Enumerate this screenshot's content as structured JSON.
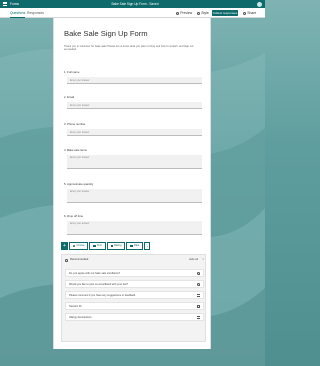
{
  "titlebar": {
    "app_name": "Forms",
    "title": "Bake Sale Sign Up Form - Saved"
  },
  "tabs": {
    "questions": "Questions",
    "responses": "Responses"
  },
  "commands": {
    "preview": "Preview",
    "style": "Style",
    "collect": "Collect responses",
    "share": "Share"
  },
  "form": {
    "title": "Bake Sale Sign Up Form",
    "description": "Thank you to volunteer for bake sale! Please let us know what you plan to bring and how to contact, and help out as needed.",
    "questions": [
      {
        "number": "1.",
        "label": "Full name",
        "placeholder": "Enter your answer"
      },
      {
        "number": "2.",
        "label": "Email",
        "placeholder": "Enter your answer"
      },
      {
        "number": "3.",
        "label": "Phone number",
        "placeholder": "Enter your answer"
      },
      {
        "number": "4.",
        "label": "Bake sale items",
        "placeholder": "Enter your answer"
      },
      {
        "number": "5.",
        "label": "Approximate quantity",
        "placeholder": "Enter your answer"
      },
      {
        "number": "6.",
        "label": "Drop off time",
        "placeholder": "Enter your answer"
      }
    ]
  },
  "add_bar": {
    "options": [
      "Choice",
      "Text",
      "Rating",
      "Date"
    ]
  },
  "recommended": {
    "title": "Recommended",
    "hide_label": "Hide all",
    "suggestions": [
      "Do you agree with our bake sale conditions?",
      "Would you like to give us a feedback with your bar?",
      "Please comment if you have any suggestions or feedback",
      "Session ID",
      "Allergy descriptions"
    ]
  },
  "colors": {
    "accent": "#0f6b6b",
    "background": "#6aa6a6"
  }
}
